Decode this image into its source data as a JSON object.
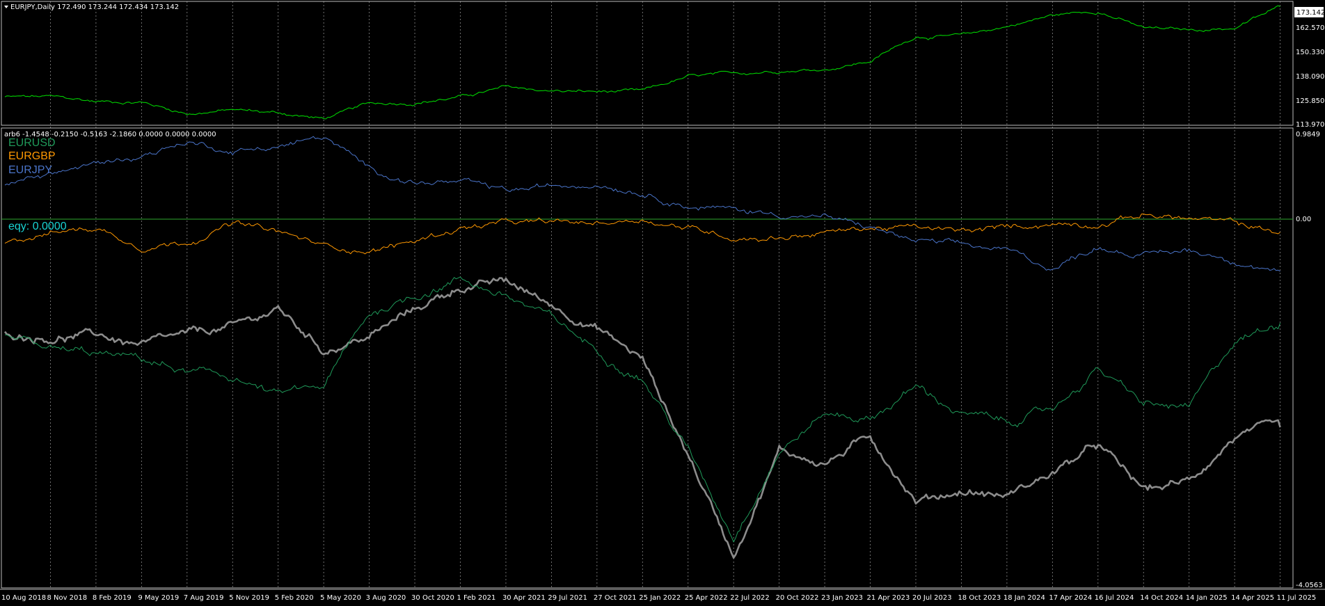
{
  "colors": {
    "background": "#000000",
    "grid": "#8a8a8a",
    "border": "#bdbdbd",
    "main_price": "#00d000",
    "eurusd": "#1f9a5a",
    "eurgbp": "#ff9800",
    "eurjpy": "#4a74c9",
    "gray_series": "#8c8c8c",
    "zero_line": "#2ea82e",
    "eqy": "#19d3d3"
  },
  "main_pane": {
    "header": "EURJPY,Daily  172.490 173.244 172.434 173.142",
    "menu_icon": "triangle-down-icon",
    "price_badge": "173.142",
    "price_labels": [
      "162.570",
      "150.330",
      "138.090",
      "125.850",
      "113.970"
    ]
  },
  "indicator_pane": {
    "header": "arb6 -1.4548 -0.2150 -0.5163 -2.1860 0.0000 0.0000 0.0000",
    "legend": [
      "EURUSD",
      "EURGBP",
      "EURJPY"
    ],
    "eqy_label": "eqy: 0.0000",
    "scale_top": "0.9849",
    "zero_label": "0.00",
    "scale_bottom": "-4.0563"
  },
  "time_axis": [
    "10 Aug 2018",
    "8 Nov 2018",
    "8 Feb 2019",
    "9 May 2019",
    "7 Aug 2019",
    "5 Nov 2019",
    "5 Feb 2020",
    "5 May 2020",
    "3 Aug 2020",
    "30 Oct 2020",
    "1 Feb 2021",
    "30 Apr 2021",
    "29 Jul 2021",
    "27 Oct 2021",
    "25 Jan 2022",
    "25 Apr 2022",
    "22 Jul 2022",
    "20 Oct 2022",
    "23 Jan 2023",
    "21 Apr 2023",
    "20 Jul 2023",
    "18 Oct 2023",
    "18 Jan 2024",
    "17 Apr 2024",
    "16 Jul 2024",
    "14 Oct 2024",
    "14 Jan 2025",
    "14 Apr 2025",
    "11 Jul 2025"
  ],
  "chart_data": [
    {
      "type": "line",
      "title": "EURJPY,Daily",
      "ylim": [
        113.97,
        174.81
      ],
      "x": [
        "10 Aug 2018",
        "8 Nov 2018",
        "8 Feb 2019",
        "9 May 2019",
        "7 Aug 2019",
        "5 Nov 2019",
        "5 Feb 2020",
        "5 May 2020",
        "3 Aug 2020",
        "30 Oct 2020",
        "1 Feb 2021",
        "30 Apr 2021",
        "29 Jul 2021",
        "27 Oct 2021",
        "25 Jan 2022",
        "25 Apr 2022",
        "22 Jul 2022",
        "20 Oct 2022",
        "23 Jan 2023",
        "21 Apr 2023",
        "20 Jul 2023",
        "18 Oct 2023",
        "18 Jan 2024",
        "17 Apr 2024",
        "16 Jul 2024",
        "14 Oct 2024",
        "14 Jan 2025",
        "14 Apr 2025",
        "11 Jul 2025"
      ],
      "series": [
        {
          "values": [
            127.5,
            127.5,
            125.2,
            125.0,
            119.2,
            121.0,
            119.5,
            116.5,
            124.0,
            124.8,
            127.5,
            132.2,
            130.5,
            130.0,
            130.2,
            137.5,
            138.9,
            141.0,
            141.5,
            145.5,
            158.0,
            158.1,
            163.0,
            168.5,
            170.9,
            162.0,
            161.0,
            162.2,
            172.9
          ]
        }
      ],
      "last_value": 173.142
    },
    {
      "type": "line",
      "title": "arb6",
      "ylim": [
        -4.0563,
        0.9849
      ],
      "x": [
        "10 Aug 2018",
        "8 Nov 2018",
        "8 Feb 2019",
        "9 May 2019",
        "7 Aug 2019",
        "5 Nov 2019",
        "5 Feb 2020",
        "5 May 2020",
        "3 Aug 2020",
        "30 Oct 2020",
        "1 Feb 2021",
        "30 Apr 2021",
        "29 Jul 2021",
        "27 Oct 2021",
        "25 Jan 2022",
        "25 Apr 2022",
        "22 Jul 2022",
        "20 Oct 2022",
        "23 Jan 2023",
        "21 Apr 2023",
        "20 Jul 2023",
        "18 Oct 2023",
        "18 Jan 2024",
        "17 Apr 2024",
        "16 Jul 2024",
        "14 Oct 2024",
        "14 Jan 2025",
        "14 Apr 2025",
        "11 Jul 2025"
      ],
      "series": [
        {
          "name": "EURUSD",
          "values": [
            -1.3,
            -1.45,
            -1.5,
            -1.55,
            -1.7,
            -1.75,
            -1.95,
            -1.85,
            -1.05,
            -0.85,
            -0.65,
            -0.85,
            -1.1,
            -1.45,
            -1.75,
            -2.55,
            -3.5,
            -2.55,
            -2.15,
            -2.2,
            -1.85,
            -2.15,
            -2.25,
            -2.1,
            -1.65,
            -2.05,
            -2.1,
            -1.35,
            -1.15
          ]
        },
        {
          "name": "EURGBP",
          "values": [
            -0.25,
            -0.15,
            -0.1,
            -0.3,
            -0.25,
            -0.05,
            -0.15,
            -0.3,
            -0.35,
            -0.25,
            -0.1,
            -0.05,
            -0.05,
            -0.05,
            0.0,
            -0.1,
            -0.2,
            -0.2,
            -0.15,
            -0.1,
            -0.1,
            -0.15,
            -0.1,
            -0.05,
            -0.05,
            0.05,
            0.0,
            -0.05,
            -0.15
          ]
        },
        {
          "name": "EURJPY",
          "values": [
            0.35,
            0.5,
            0.6,
            0.7,
            0.85,
            0.75,
            0.8,
            0.9,
            0.55,
            0.4,
            0.4,
            0.3,
            0.35,
            0.4,
            0.3,
            0.15,
            0.1,
            0.05,
            0.02,
            -0.1,
            -0.25,
            -0.3,
            -0.35,
            -0.55,
            -0.3,
            -0.4,
            -0.35,
            -0.45,
            -0.58
          ]
        },
        {
          "values": [
            -1.25,
            -1.3,
            -1.28,
            -1.4,
            -1.3,
            -1.2,
            -1.0,
            -1.45,
            -1.3,
            -1.0,
            -0.75,
            -0.7,
            -0.95,
            -1.2,
            -1.55,
            -2.6,
            -3.7,
            -2.55,
            -2.7,
            -2.4,
            -3.1,
            -3.0,
            -3.05,
            -2.8,
            -2.5,
            -3.0,
            -2.9,
            -2.4,
            -2.3
          ]
        }
      ]
    }
  ]
}
